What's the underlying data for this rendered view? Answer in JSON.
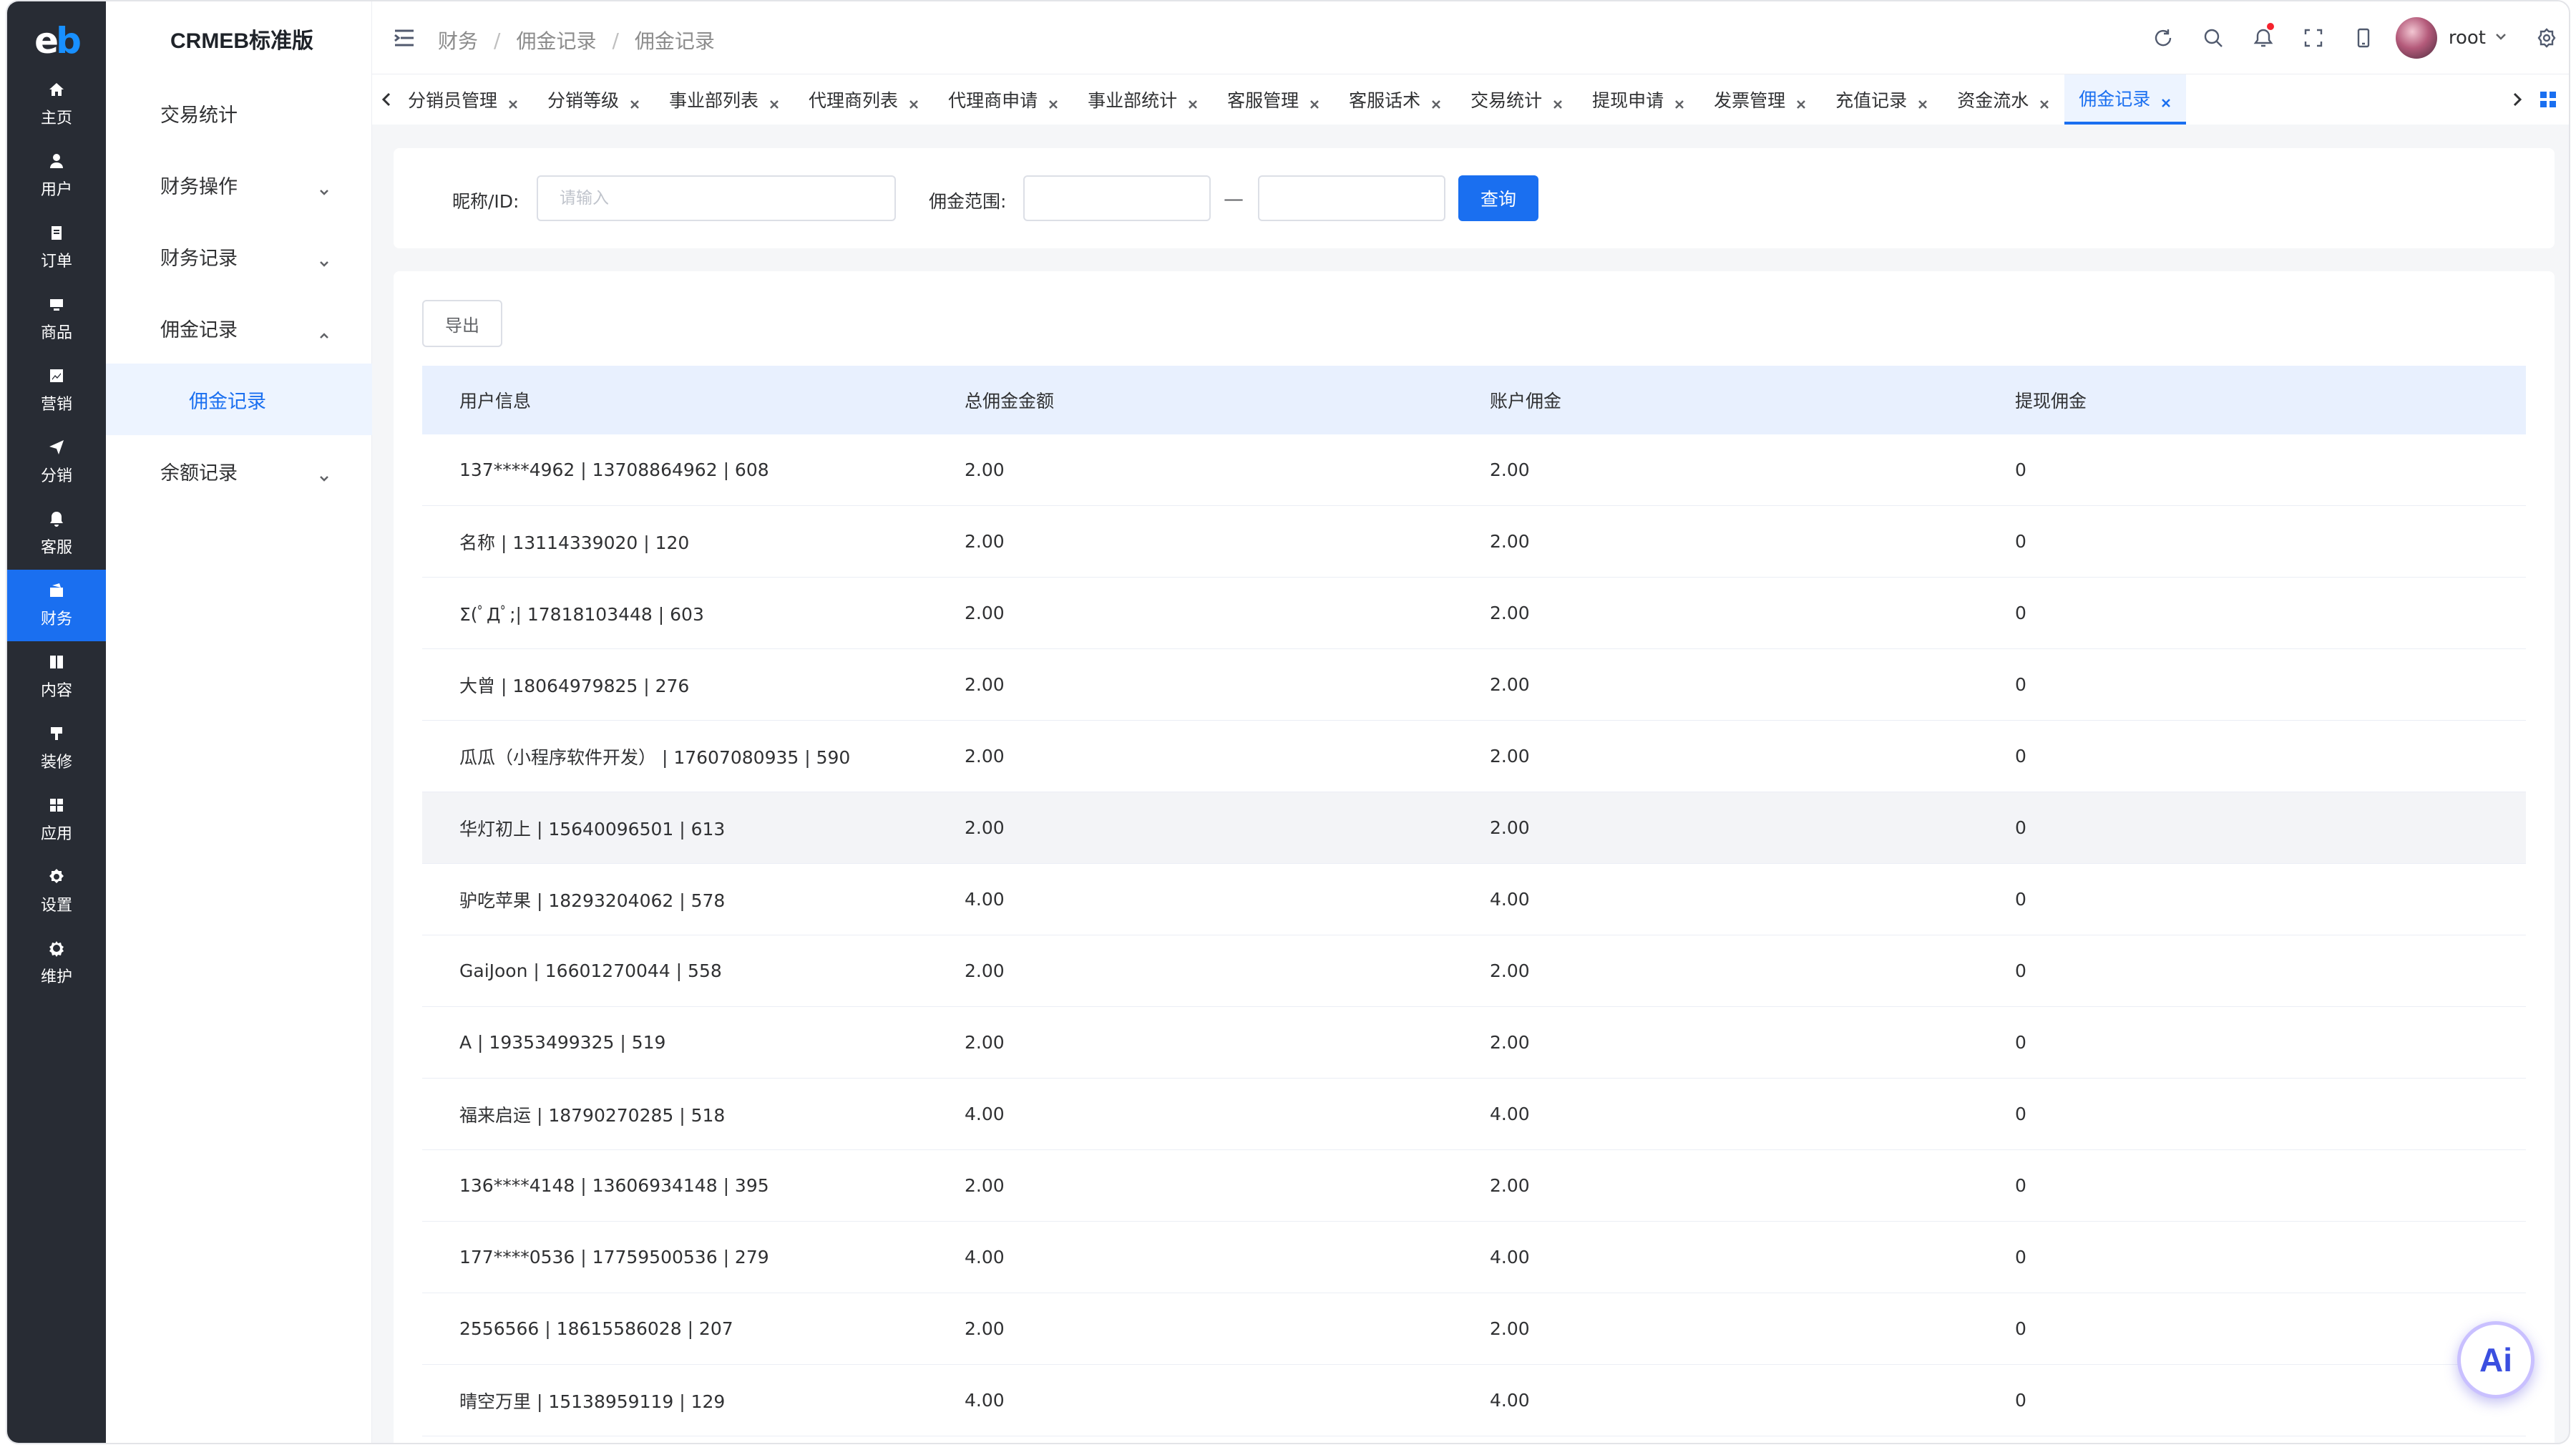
{
  "app": {
    "title": "CRMEB标准版"
  },
  "rail": [
    {
      "label": "主页",
      "icon": "home-icon"
    },
    {
      "label": "用户",
      "icon": "user-icon"
    },
    {
      "label": "订单",
      "icon": "order-icon"
    },
    {
      "label": "商品",
      "icon": "product-icon"
    },
    {
      "label": "营销",
      "icon": "marketing-icon"
    },
    {
      "label": "分销",
      "icon": "distribution-icon"
    },
    {
      "label": "客服",
      "icon": "service-icon"
    },
    {
      "label": "财务",
      "icon": "finance-icon",
      "active": true
    },
    {
      "label": "内容",
      "icon": "content-icon"
    },
    {
      "label": "装修",
      "icon": "decor-icon"
    },
    {
      "label": "应用",
      "icon": "apps-icon"
    },
    {
      "label": "设置",
      "icon": "settings-icon"
    },
    {
      "label": "维护",
      "icon": "maintain-icon"
    }
  ],
  "menu": [
    {
      "label": "交易统计"
    },
    {
      "label": "财务操作"
    },
    {
      "label": "财务记录"
    },
    {
      "label": "佣金记录"
    },
    {
      "label": "佣金记录"
    },
    {
      "label": "余额记录"
    }
  ],
  "breadcrumb": [
    "财务",
    "佣金记录",
    "佣金记录"
  ],
  "header": {
    "user": "root"
  },
  "tabs": [
    "分销员管理",
    "分销等级",
    "事业部列表",
    "代理商列表",
    "代理商申请",
    "事业部统计",
    "客服管理",
    "客服话术",
    "交易统计",
    "提现申请",
    "发票管理",
    "充值记录",
    "资金流水",
    "佣金记录"
  ],
  "filter": {
    "nickname_label": "昵称/ID:",
    "nickname_placeholder": "请输入",
    "range_label": "佣金范围:",
    "range_sep": "—",
    "query_label": "查询"
  },
  "table": {
    "export_label": "导出",
    "columns": [
      "用户信息",
      "总佣金金额",
      "账户佣金",
      "提现佣金"
    ],
    "rows": [
      [
        "137****4962 | 13708864962 | 608",
        "2.00",
        "2.00",
        "0"
      ],
      [
        "名称 | 13114339020 | 120",
        "2.00",
        "2.00",
        "0"
      ],
      [
        "Σ(ﾟДﾟ;| 17818103448 | 603",
        "2.00",
        "2.00",
        "0"
      ],
      [
        "大曾 | 18064979825 | 276",
        "2.00",
        "2.00",
        "0"
      ],
      [
        "瓜瓜（小程序软件开发） | 17607080935 | 590",
        "2.00",
        "2.00",
        "0"
      ],
      [
        "华灯初上 | 15640096501 | 613",
        "2.00",
        "2.00",
        "0"
      ],
      [
        "驴吃苹果 | 18293204062 | 578",
        "4.00",
        "4.00",
        "0"
      ],
      [
        "GaiJoon | 16601270044 | 558",
        "2.00",
        "2.00",
        "0"
      ],
      [
        "A | 19353499325 | 519",
        "2.00",
        "2.00",
        "0"
      ],
      [
        "福来启运 | 18790270285 | 518",
        "4.00",
        "4.00",
        "0"
      ],
      [
        "136****4148 | 13606934148 | 395",
        "2.00",
        "2.00",
        "0"
      ],
      [
        "177****0536 | 17759500536 | 279",
        "4.00",
        "4.00",
        "0"
      ],
      [
        "2556566 | 18615586028 | 207",
        "2.00",
        "2.00",
        "0"
      ],
      [
        "晴空万里 | 15138959119 | 129",
        "4.00",
        "4.00",
        "0"
      ]
    ],
    "highlight_row": 5
  },
  "ai": {
    "label": "Ai"
  }
}
